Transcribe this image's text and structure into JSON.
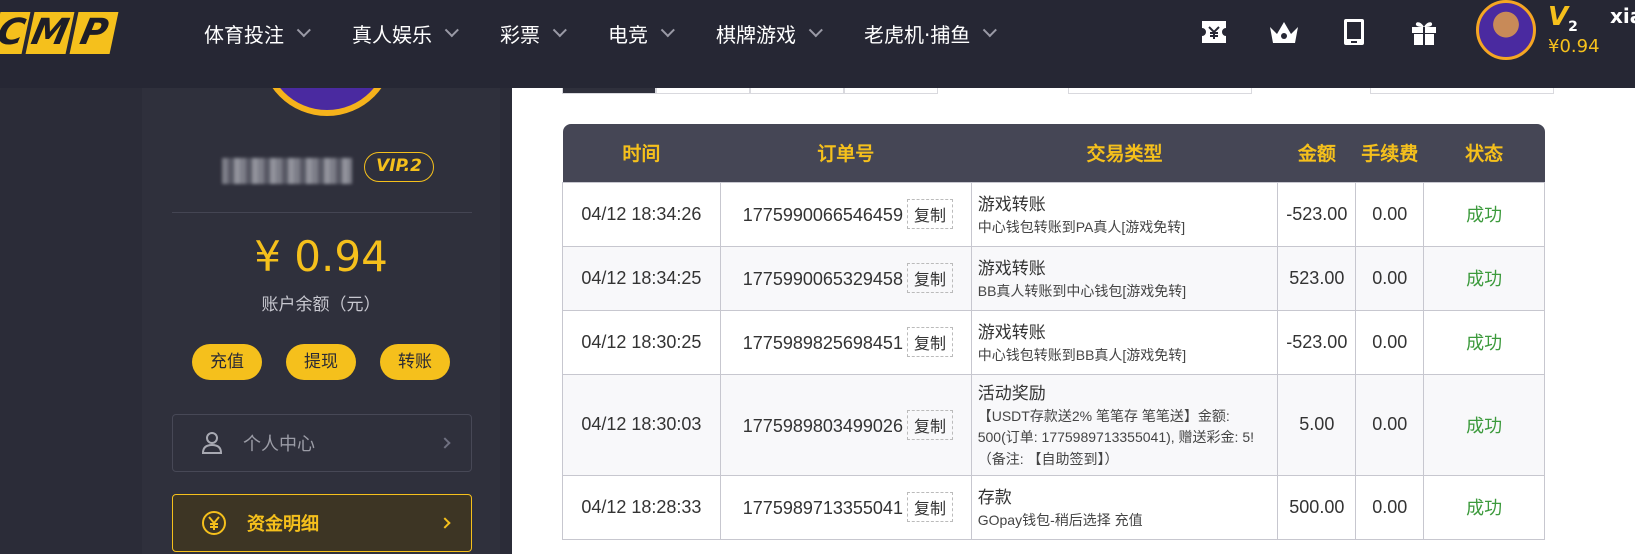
{
  "brand": {
    "logo_letters": [
      "C",
      "M",
      "P"
    ]
  },
  "nav": {
    "items": [
      {
        "label": "体育投注"
      },
      {
        "label": "真人娱乐"
      },
      {
        "label": "彩票"
      },
      {
        "label": "电竞"
      },
      {
        "label": "棋牌游戏"
      },
      {
        "label": "老虎机·捕鱼"
      }
    ]
  },
  "topbar": {
    "icons": [
      "ticket-icon",
      "crown-icon",
      "tablet-icon",
      "gift-icon"
    ],
    "vip_level": "V",
    "vip_level_num": "2",
    "balance": "¥0.94",
    "username": "xia"
  },
  "sidebar": {
    "vip_badge": "VIP.2",
    "balance": "¥ 0.94",
    "balance_label": "账户余额（元）",
    "buttons": [
      {
        "label": "充值"
      },
      {
        "label": "提现"
      },
      {
        "label": "转账"
      }
    ],
    "menu": [
      {
        "label": "个人中心"
      },
      {
        "label": "资金明细"
      }
    ]
  },
  "table": {
    "headers": [
      "时间",
      "订单号",
      "交易类型",
      "金额",
      "手续费",
      "状态"
    ],
    "copy_label": "复制",
    "rows": [
      {
        "time": "04/12 18:34:26",
        "order": "1775990066546459",
        "type": "游戏转账",
        "desc": "中心钱包转账到PA真人[游戏免转]",
        "amount": "-523.00",
        "fee": "0.00",
        "status": "成功"
      },
      {
        "time": "04/12 18:34:25",
        "order": "1775990065329458",
        "type": "游戏转账",
        "desc": "BB真人转账到中心钱包[游戏免转]",
        "amount": "523.00",
        "fee": "0.00",
        "status": "成功"
      },
      {
        "time": "04/12 18:30:25",
        "order": "1775989825698451",
        "type": "游戏转账",
        "desc": "中心钱包转账到BB真人[游戏免转]",
        "amount": "-523.00",
        "fee": "0.00",
        "status": "成功"
      },
      {
        "time": "04/12 18:30:03",
        "order": "1775989803499026",
        "type": "活动奖励",
        "desc": "【USDT存款送2% 笔笔存 笔笔送】金额: 500(订单: 1775989713355041), 赠送彩金: 5! （备注: 【自助签到】）",
        "amount": "5.00",
        "fee": "0.00",
        "status": "成功"
      },
      {
        "time": "04/12 18:28:33",
        "order": "1775989713355041",
        "type": "存款",
        "desc": "GOpay钱包-稍后选择 充值",
        "amount": "500.00",
        "fee": "0.00",
        "status": "成功"
      }
    ]
  }
}
